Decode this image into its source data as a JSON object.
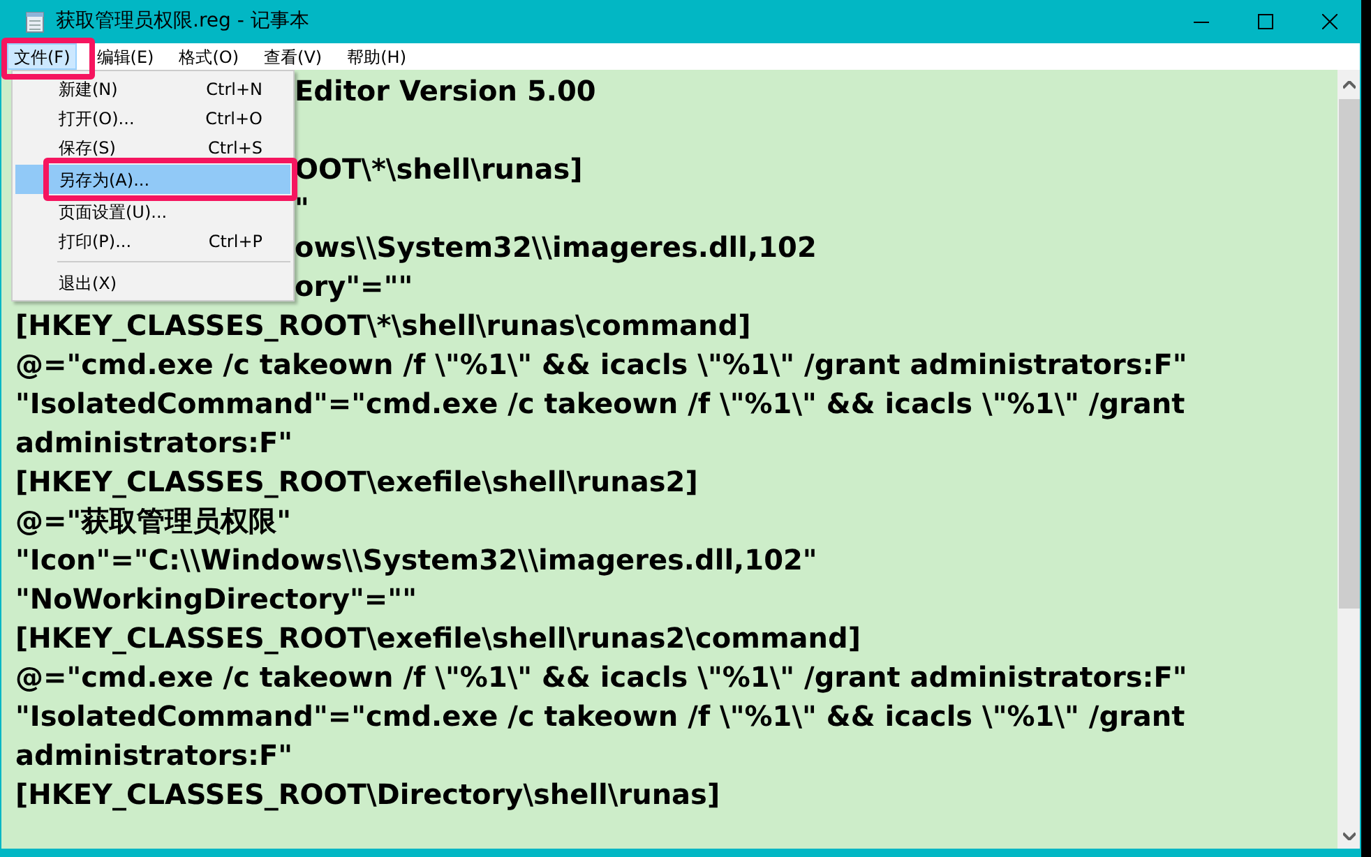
{
  "window": {
    "title": "获取管理员权限.reg - 记事本"
  },
  "menu_bar": [
    {
      "label": "文件(F)",
      "selected": true
    },
    {
      "label": "编辑(E)",
      "selected": false
    },
    {
      "label": "格式(O)",
      "selected": false
    },
    {
      "label": "查看(V)",
      "selected": false
    },
    {
      "label": "帮助(H)",
      "selected": false
    }
  ],
  "file_menu": [
    {
      "kind": "item",
      "label": "新建(N)",
      "shortcut": "Ctrl+N",
      "selected": false
    },
    {
      "kind": "item",
      "label": "打开(O)...",
      "shortcut": "Ctrl+O",
      "selected": false
    },
    {
      "kind": "item",
      "label": "保存(S)",
      "shortcut": "Ctrl+S",
      "selected": false
    },
    {
      "kind": "item",
      "label": "另存为(A)...",
      "selected": true
    },
    {
      "kind": "item",
      "label": "页面设置(U)...",
      "selected": false
    },
    {
      "kind": "item",
      "label": "打印(P)...",
      "shortcut": "Ctrl+P",
      "selected": false
    },
    {
      "kind": "separator"
    },
    {
      "kind": "item",
      "label": "退出(X)",
      "selected": false
    }
  ],
  "editor": {
    "partly_covered_lines": [
      "Editor Version 5.00",
      "OOT\\*\\shell\\runas]",
      "\"",
      "ows\\\\System32\\\\imageres.dll,102",
      "ory\"=\"\""
    ],
    "lines": [
      "[HKEY_CLASSES_ROOT\\*\\shell\\runas\\command]",
      "@=\"cmd.exe /c takeown /f \\\"%1\\\" && icacls \\\"%1\\\" /grant administrators:F\"",
      "\"IsolatedCommand\"=\"cmd.exe /c takeown /f \\\"%1\\\" && icacls \\\"%1\\\" /grant",
      "administrators:F\"",
      "[HKEY_CLASSES_ROOT\\exefile\\shell\\runas2]",
      "@=\"获取管理员权限\"",
      "\"Icon\"=\"C:\\\\Windows\\\\System32\\\\imageres.dll,102\"",
      "\"NoWorkingDirectory\"=\"\"",
      "[HKEY_CLASSES_ROOT\\exefile\\shell\\runas2\\command]",
      "@=\"cmd.exe /c takeown /f \\\"%1\\\" && icacls \\\"%1\\\" /grant administrators:F\"",
      "\"IsolatedCommand\"=\"cmd.exe /c takeown /f \\\"%1\\\" && icacls \\\"%1\\\" /grant",
      "administrators:F\"",
      "[HKEY_CLASSES_ROOT\\Directory\\shell\\runas]"
    ]
  }
}
